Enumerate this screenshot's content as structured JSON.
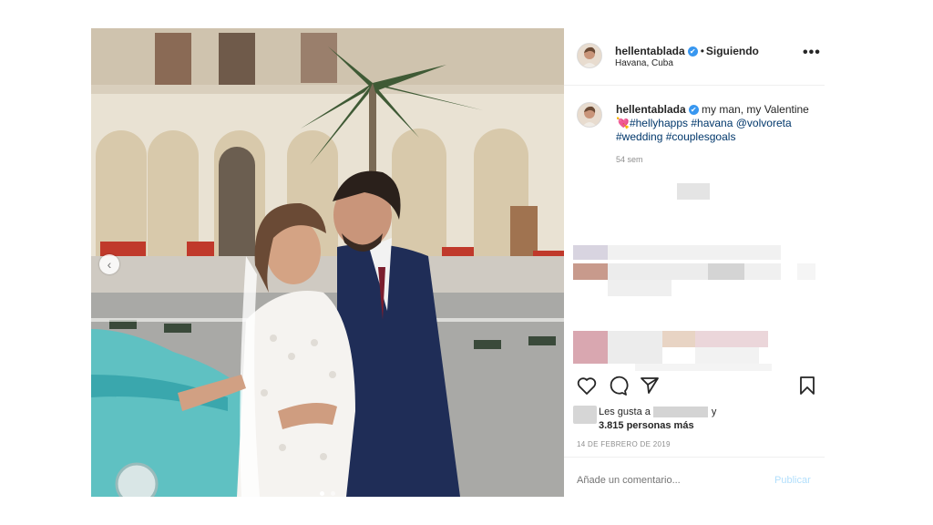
{
  "header": {
    "username": "hellentablada",
    "verified_mark": "✔",
    "separator": "•",
    "follow_status": "Siguiendo",
    "location": "Havana, Cuba",
    "more_label": "•••"
  },
  "caption": {
    "username": "hellentablada",
    "text_part1": " my man, my Valentine ",
    "emoji": "💘",
    "tags": [
      "#hellyhapps",
      "#havana",
      "@volvoreta",
      "#wedding",
      "#couplesgoals"
    ],
    "time": "54 sem"
  },
  "photo": {
    "prev_arrow": "‹",
    "carousel_dots": 2
  },
  "likes": {
    "prefix": "Les gusta a",
    "suffix": "y",
    "count_text": "3.815 personas más"
  },
  "date": "14 DE FEBRERO DE 2019",
  "comment": {
    "placeholder": "Añade un comentario...",
    "publish_label": "Publicar"
  },
  "icons": [
    "heart-icon",
    "comment-icon",
    "share-icon",
    "bookmark-icon",
    "more-options-icon",
    "verified-icon"
  ]
}
